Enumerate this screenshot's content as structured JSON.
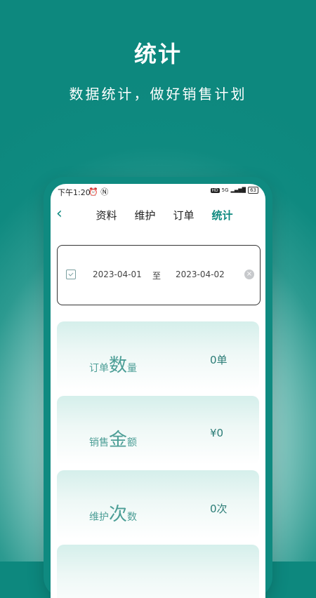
{
  "promo": {
    "title": "统计",
    "subtitle": "数据统计，做好销售计划"
  },
  "status_bar": {
    "time": "下午1:20",
    "left_icons": "⏰ Ⓝ",
    "hd": "HD",
    "network": "5G",
    "signal": "▂▄▆█",
    "battery": "63"
  },
  "nav": {
    "back_icon": "‹",
    "tabs": [
      "资料",
      "维护",
      "订单",
      "统计"
    ],
    "active_tab": "统计"
  },
  "date_range": {
    "start": "2023-04-01",
    "separator": "至",
    "end": "2023-04-02",
    "clear_icon": "×"
  },
  "stats": [
    {
      "label_pre": "订单",
      "label_big": "数",
      "label_post": "量",
      "value": "0单"
    },
    {
      "label_pre": "销售",
      "label_big": "金",
      "label_post": "额",
      "value": "¥0"
    },
    {
      "label_pre": "维护",
      "label_big": "次",
      "label_post": "数",
      "value": "0次"
    }
  ],
  "colors": {
    "accent": "#0f8a80",
    "stat_label": "#4c9e96"
  }
}
